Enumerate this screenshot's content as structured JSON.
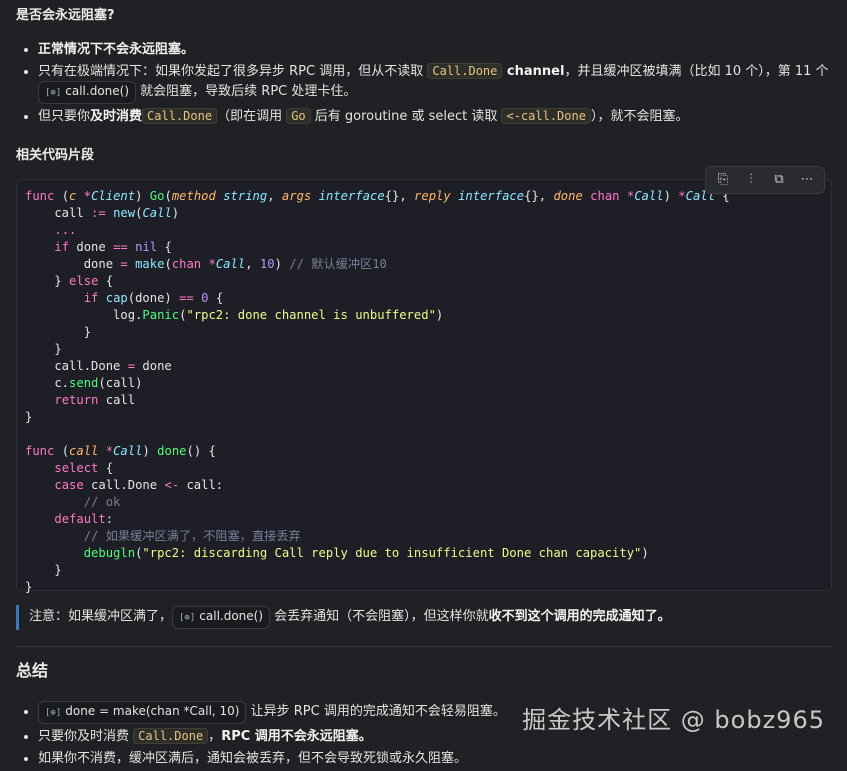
{
  "question": "是否会永远阻塞?",
  "answer_items": [
    {
      "b": "正常情况下不会永远阻塞。"
    },
    {
      "t1": "只有在极端情况下：如果你发起了很多异步 RPC 调用，但从不读取 ",
      "code1": "Call.Done",
      "b1": " channel",
      "t2": "，并且缓冲区被填满（比如 10 个），第 11 个 ",
      "chip": "call.done()",
      "t3": " 就会阻塞，导致后续 RPC 处理卡住。"
    },
    {
      "t1": "但只要你",
      "b1": "及时消费",
      "code1": "Call.Done",
      "t2": "（即在调用 ",
      "code2": "Go",
      "t3": " 后有 goroutine 或 select 读取 ",
      "code3": "<-call.Done",
      "t4": "），就不会阻塞。"
    }
  ],
  "code_title": "相关代码片段",
  "code_toolbar": {
    "btn1": "⎘",
    "btn2": "⫶",
    "btn3": "⧉",
    "more": "⋯"
  },
  "note": {
    "t1": "注意：如果缓冲区满了，",
    "chip": "call.done()",
    "t2": " 会丢弃通知（不会阻塞），但这样你就",
    "b": "收不到这个调用的完成通知了。"
  },
  "summary_title": "总结",
  "summary_items": [
    {
      "chip": "done = make(chan *Call, 10)",
      "t": " 让异步 RPC 调用的完成通知不会轻易阻塞。"
    },
    {
      "t1": "只要你及时消费 ",
      "code": "Call.Done",
      "t2": "，",
      "b": "RPC 调用不会永远阻塞。"
    },
    {
      "t": "如果你不消费，缓冲区满后，通知会被丢弃，但不会导致死锁或永久阻塞。"
    }
  ],
  "watermark": "掘金技术社区 @ bobz965"
}
